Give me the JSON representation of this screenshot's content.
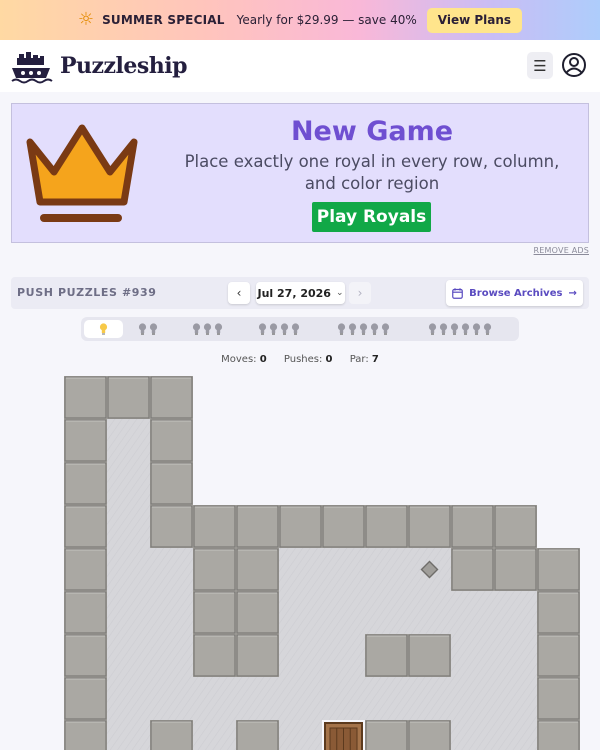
{
  "promo": {
    "title": "SUMMER SPECIAL",
    "offer": "Yearly for $29.99 — save 40%",
    "button": "View Plans",
    "icon": "sun-icon"
  },
  "header": {
    "logo_text": "Puzzleship",
    "menu_icon": "hamburger-icon",
    "user_icon": "user-circle-icon"
  },
  "ad": {
    "title": "New Game",
    "subtitle": "Place exactly one royal in every row, column, and color region",
    "button": "Play Royals",
    "remove_ads": "REMOVE ADS",
    "icon": "crown-icon"
  },
  "toolbar": {
    "title": "PUSH PUZZLES #939",
    "prev": "‹",
    "date": "Jul 27, 2026",
    "next": "›",
    "browse": "Browse Archives"
  },
  "hints": {
    "levels": [
      1,
      2,
      3,
      4,
      5,
      6
    ],
    "active": 0
  },
  "stats": {
    "moves_label": "Moves:",
    "moves": "0",
    "pushes_label": "Pushes:",
    "pushes": "0",
    "par_label": "Par:",
    "par": "7"
  },
  "board": {
    "walls": [
      [
        0,
        0
      ],
      [
        1,
        0
      ],
      [
        2,
        0
      ],
      [
        0,
        1
      ],
      [
        2,
        1
      ],
      [
        0,
        2
      ],
      [
        2,
        2
      ],
      [
        0,
        3
      ],
      [
        2,
        3
      ],
      [
        3,
        3
      ],
      [
        4,
        3
      ],
      [
        5,
        3
      ],
      [
        6,
        3
      ],
      [
        7,
        3
      ],
      [
        8,
        3
      ],
      [
        9,
        3
      ],
      [
        10,
        3
      ],
      [
        0,
        4
      ],
      [
        3,
        4
      ],
      [
        4,
        4
      ],
      [
        9,
        4
      ],
      [
        10,
        4
      ],
      [
        11,
        4
      ],
      [
        0,
        5
      ],
      [
        3,
        5
      ],
      [
        4,
        5
      ],
      [
        11,
        5
      ],
      [
        0,
        6
      ],
      [
        3,
        6
      ],
      [
        4,
        6
      ],
      [
        7,
        6
      ],
      [
        8,
        6
      ],
      [
        11,
        6
      ],
      [
        0,
        7
      ],
      [
        11,
        7
      ],
      [
        0,
        8
      ],
      [
        2,
        8
      ],
      [
        4,
        8
      ],
      [
        7,
        8
      ],
      [
        8,
        8
      ],
      [
        11,
        8
      ]
    ],
    "floor": [
      [
        1,
        1
      ],
      [
        1,
        2
      ],
      [
        1,
        3
      ],
      [
        1,
        4
      ],
      [
        2,
        4
      ],
      [
        5,
        4
      ],
      [
        6,
        4
      ],
      [
        7,
        4
      ],
      [
        8,
        4
      ],
      [
        1,
        5
      ],
      [
        2,
        5
      ],
      [
        5,
        5
      ],
      [
        6,
        5
      ],
      [
        7,
        5
      ],
      [
        8,
        5
      ],
      [
        9,
        5
      ],
      [
        10,
        5
      ],
      [
        1,
        6
      ],
      [
        2,
        6
      ],
      [
        5,
        6
      ],
      [
        6,
        6
      ],
      [
        9,
        6
      ],
      [
        10,
        6
      ],
      [
        1,
        7
      ],
      [
        2,
        7
      ],
      [
        3,
        7
      ],
      [
        4,
        7
      ],
      [
        5,
        7
      ],
      [
        6,
        7
      ],
      [
        7,
        7
      ],
      [
        8,
        7
      ],
      [
        9,
        7
      ],
      [
        10,
        7
      ],
      [
        1,
        8
      ],
      [
        3,
        8
      ],
      [
        5,
        8
      ],
      [
        9,
        8
      ],
      [
        10,
        8
      ]
    ],
    "goals": [
      [
        8,
        4
      ]
    ],
    "crates": [
      [
        6,
        8
      ]
    ]
  }
}
